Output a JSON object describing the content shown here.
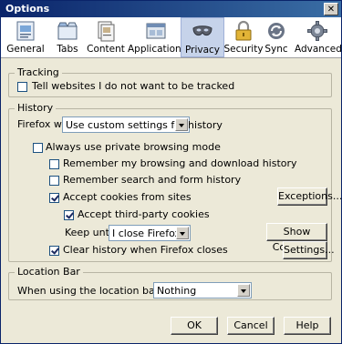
{
  "window": {
    "title": "Options",
    "close_glyph": "✕"
  },
  "tabs": [
    {
      "label": "General",
      "icon": "general-icon"
    },
    {
      "label": "Tabs",
      "icon": "tabs-icon"
    },
    {
      "label": "Content",
      "icon": "content-icon"
    },
    {
      "label": "Applications",
      "icon": "applications-icon"
    },
    {
      "label": "Privacy",
      "icon": "privacy-mask-icon",
      "selected": true
    },
    {
      "label": "Security",
      "icon": "padlock-icon"
    },
    {
      "label": "Sync",
      "icon": "sync-icon"
    },
    {
      "label": "Advanced",
      "icon": "gear-icon"
    }
  ],
  "tracking": {
    "legend": "Tracking",
    "dnt_label": "Tell websites I do not want to be tracked",
    "dnt_checked": false
  },
  "history": {
    "legend": "History",
    "firefox_will_label": "Firefox will:",
    "firefox_will_value": "Use custom settings for history",
    "private_label": "Always use private browsing mode",
    "private_checked": false,
    "remember_browsing_label": "Remember my browsing and download history",
    "remember_browsing_checked": false,
    "remember_search_label": "Remember search and form history",
    "remember_search_checked": false,
    "accept_cookies_label": "Accept cookies from sites",
    "accept_cookies_checked": true,
    "exceptions_button": "Exceptions...",
    "third_party_label": "Accept third-party cookies",
    "third_party_checked": true,
    "keep_until_label": "Keep until:",
    "keep_until_value": "I close Firefox",
    "show_cookies_button": "Show Cookies...",
    "clear_history_label": "Clear history when Firefox closes",
    "clear_history_checked": true,
    "settings_button": "Settings..."
  },
  "location_bar": {
    "legend": "Location Bar",
    "suggest_label": "When using the location bar, suggest:",
    "suggest_value": "Nothing"
  },
  "footer": {
    "ok": "OK",
    "cancel": "Cancel",
    "help": "Help"
  }
}
